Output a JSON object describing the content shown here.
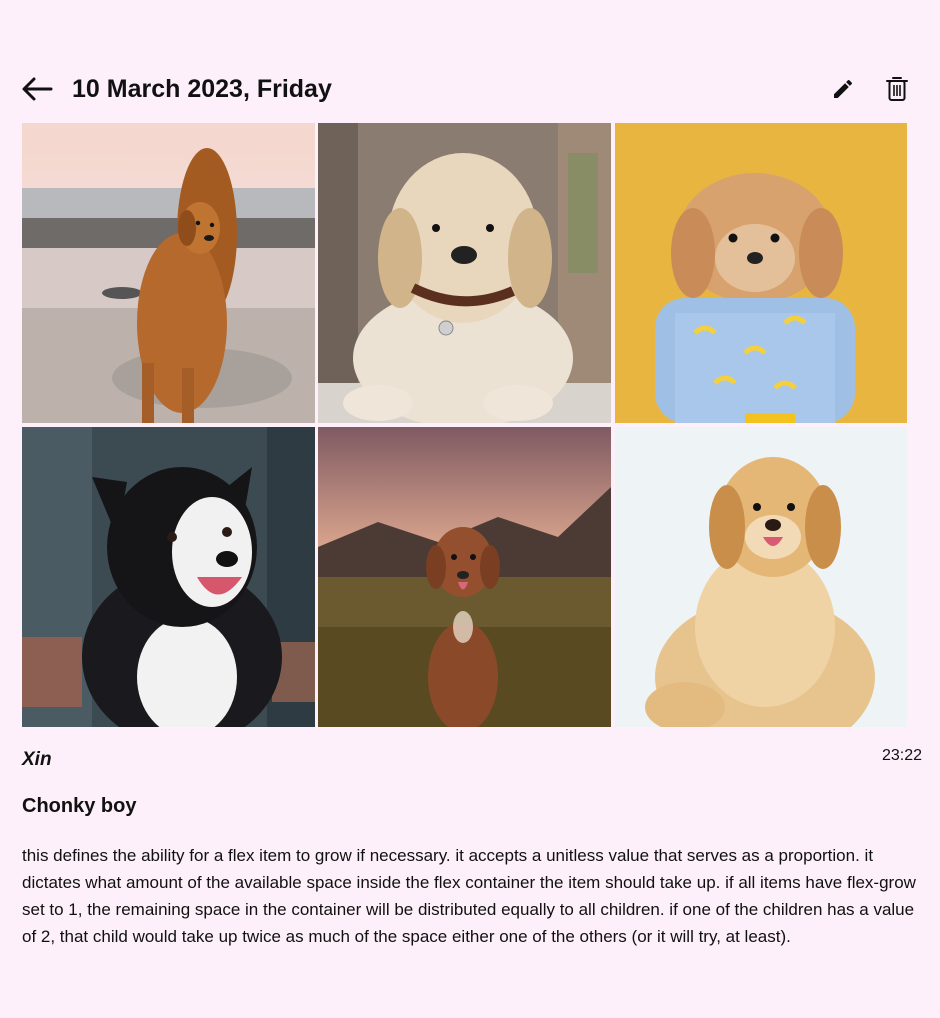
{
  "header": {
    "title": "10 March 2023, Friday",
    "back_icon": "arrow-left-icon",
    "edit_icon": "pencil-icon",
    "delete_icon": "trash-icon"
  },
  "photos": [
    {
      "subject": "golden retriever on beach",
      "bg": "#c9b7a8"
    },
    {
      "subject": "golden retriever puppy",
      "bg": "#9c8c7f"
    },
    {
      "subject": "poodle mix in banana shirt",
      "bg": "#e8b640"
    },
    {
      "subject": "border collie",
      "bg": "#3d4a52"
    },
    {
      "subject": "brown dog in field at sunset",
      "bg": "#7a5a4f"
    },
    {
      "subject": "golden dog on white",
      "bg": "#e9eff3"
    }
  ],
  "post": {
    "author": "Xin",
    "time": "23:22",
    "title": "Chonky boy",
    "body": "this defines the ability for a flex item to grow if necessary. it accepts a unitless value that serves as a proportion. it dictates what amount of the available space inside the flex container the item should take up. if all items have flex-grow set to 1, the remaining space in the container will be distributed equally to all children. if one of the children has a value of 2, that child would take up twice as much of the space either one of the others (or it will try, at least)."
  }
}
